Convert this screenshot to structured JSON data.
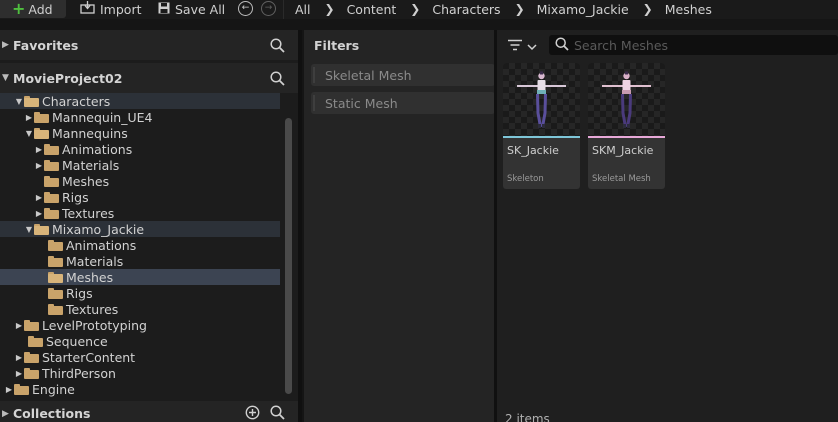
{
  "toolbar": {
    "add_label": "Add",
    "import_label": "Import",
    "save_all_label": "Save All"
  },
  "breadcrumb": [
    "All",
    "Content",
    "Characters",
    "Mixamo_Jackie",
    "Meshes"
  ],
  "sidebar": {
    "favorites_label": "Favorites",
    "project_label": "MovieProject02",
    "collections_label": "Collections",
    "tree": [
      {
        "label": "Characters",
        "arrow": "▼"
      },
      {
        "label": "Mannequin_UE4",
        "arrow": "▶"
      },
      {
        "label": "Mannequins",
        "arrow": "▼"
      },
      {
        "label": "Animations",
        "arrow": "▶"
      },
      {
        "label": "Materials",
        "arrow": "▶"
      },
      {
        "label": "Meshes",
        "arrow": ""
      },
      {
        "label": "Rigs",
        "arrow": "▶"
      },
      {
        "label": "Textures",
        "arrow": "▶"
      },
      {
        "label": "Mixamo_Jackie",
        "arrow": "▼"
      },
      {
        "label": "Animations",
        "arrow": ""
      },
      {
        "label": "Materials",
        "arrow": ""
      },
      {
        "label": "Meshes",
        "arrow": ""
      },
      {
        "label": "Rigs",
        "arrow": ""
      },
      {
        "label": "Textures",
        "arrow": ""
      },
      {
        "label": "LevelPrototyping",
        "arrow": "▶"
      },
      {
        "label": "Sequence",
        "arrow": ""
      },
      {
        "label": "StarterContent",
        "arrow": "▶"
      },
      {
        "label": "ThirdPerson",
        "arrow": "▶"
      },
      {
        "label": "Engine",
        "arrow": "▶"
      }
    ]
  },
  "filters": {
    "title": "Filters",
    "items": [
      "Skeletal Mesh",
      "Static Mesh"
    ]
  },
  "content": {
    "search_placeholder": "Search Meshes",
    "assets": [
      {
        "name": "SK_Jackie",
        "type": "Skeleton",
        "accent": "#7ec6d8"
      },
      {
        "name": "SKM_Jackie",
        "type": "Skeletal Mesh",
        "accent": "#e7a8d8"
      }
    ],
    "item_count": "2 items"
  }
}
